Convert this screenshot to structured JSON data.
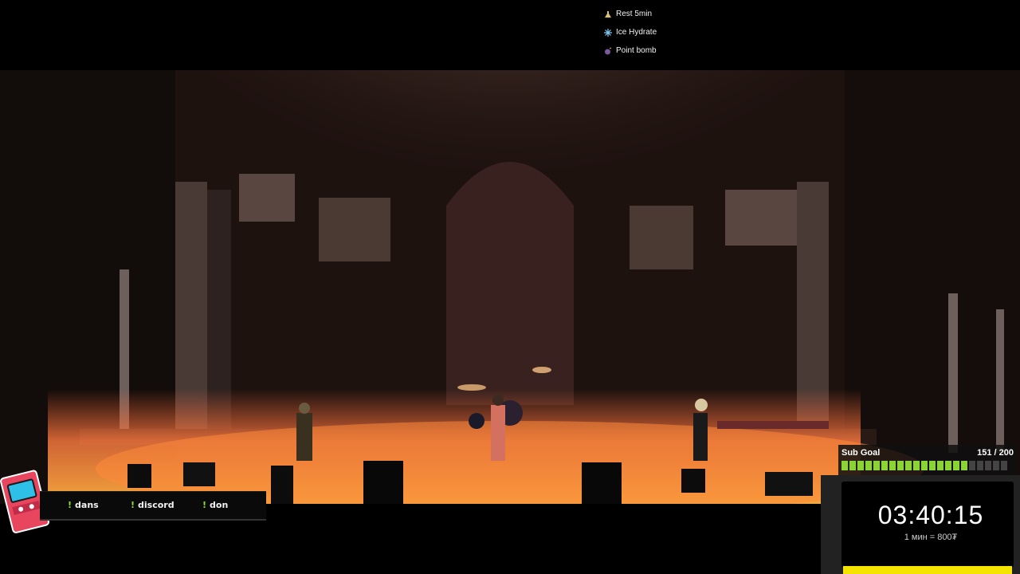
{
  "rewards": [
    {
      "icon": "flask-icon",
      "label": "Rest 5min"
    },
    {
      "icon": "snowflake-icon",
      "label": "Ice Hydrate"
    },
    {
      "icon": "bomb-icon",
      "label": "Point bomb"
    }
  ],
  "commands": [
    {
      "prefix": "!",
      "label": "dans"
    },
    {
      "prefix": "!",
      "label": "discord"
    },
    {
      "prefix": "!",
      "label": "don"
    }
  ],
  "sub_goal": {
    "label": "Sub Goal",
    "current": "151",
    "target": "200",
    "count_text": "151 / 200",
    "progress": 0.755,
    "accent": "#8bd436"
  },
  "timer": {
    "value": "03:40:15",
    "rate": "1 мин = 800₮"
  },
  "colors": {
    "accent_green": "#8be02a",
    "timer_frame": "#222222",
    "bottom_strip": "#f5e400"
  }
}
